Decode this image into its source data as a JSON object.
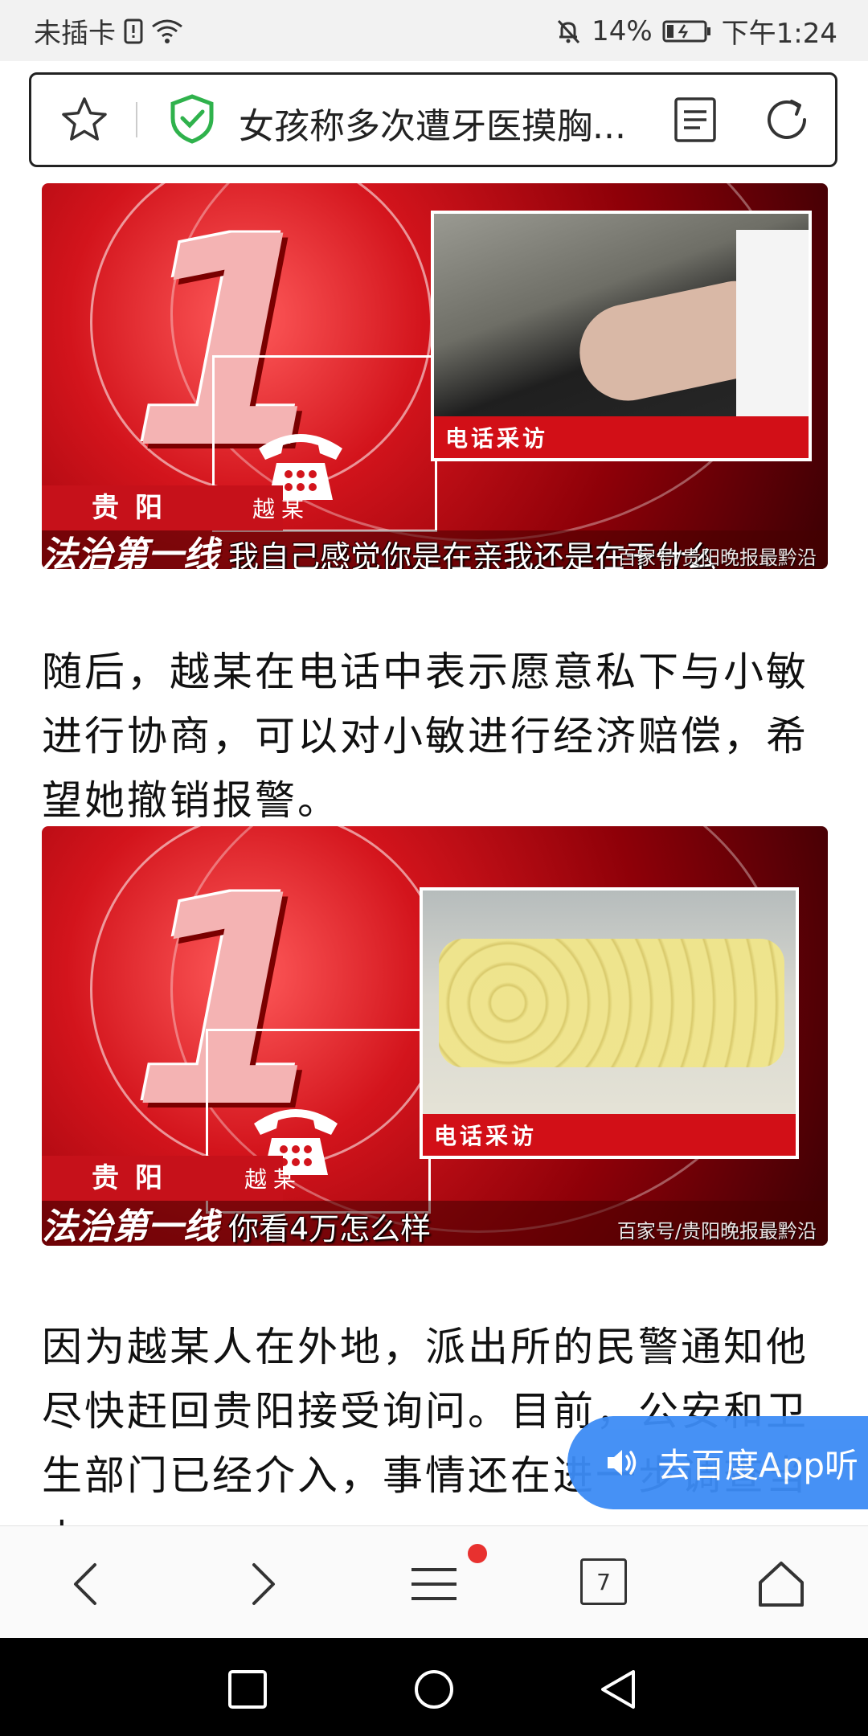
{
  "status_bar": {
    "carrier": "未插卡",
    "battery": "14%",
    "time": "下午1:24"
  },
  "address_bar": {
    "title": "女孩称多次遭牙医摸胸..."
  },
  "images": [
    {
      "location": "贵阳",
      "speaker": "越某",
      "label": "电话采访",
      "caption": "我自己感觉你是在亲我还是在干什么",
      "logo_text": "法治第一线",
      "watermark": "百家号/贵阳晚报最黔沿"
    },
    {
      "location": "贵阳",
      "speaker": "越某",
      "label": "电话采访",
      "caption": "你看4万怎么样",
      "logo_text": "法治第一线",
      "watermark": "百家号/贵阳晚报最黔沿"
    }
  ],
  "paragraphs": [
    "随后，越某在电话中表示愿意私下与小敏进行协商，可以对小敏进行经济赔偿，希望她撤销报警。",
    "因为越某人在外地，派出所的民警通知他尽快赶回贵阳接受询问。目前，公安和卫生部门已经介入，事情还在进一步调查当中。"
  ],
  "listen_button": {
    "label": "去百度App听"
  },
  "toolbar": {
    "tab_count": "7"
  },
  "colors": {
    "listen_button": "#3d8cf5",
    "shield_green": "#2fb24c",
    "notification_dot": "#e8312f",
    "news_red": "#c6111a"
  }
}
